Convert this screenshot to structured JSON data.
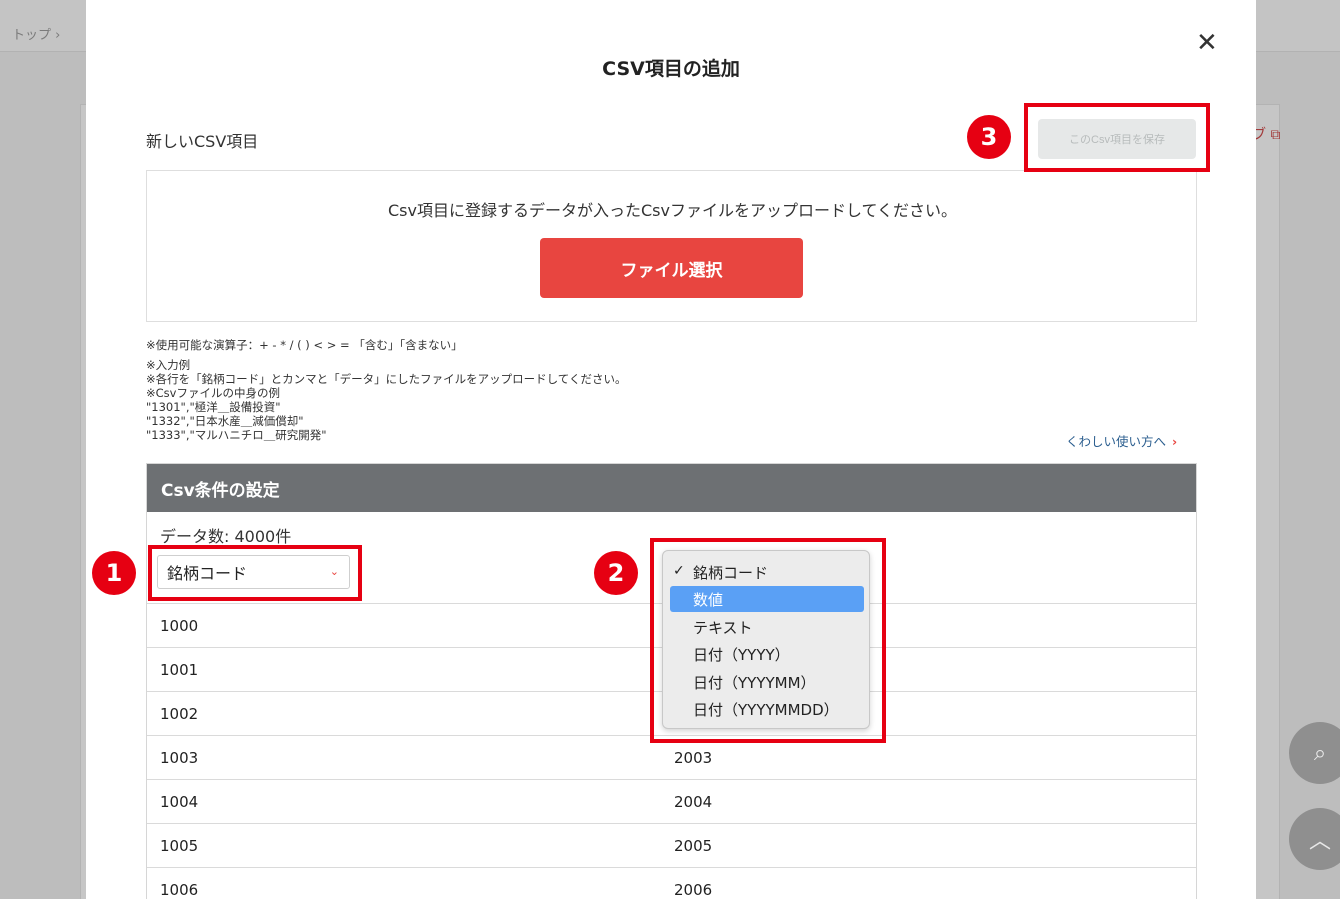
{
  "background": {
    "breadcrumb": "トップ ›",
    "external_link": "ブ ⧉"
  },
  "modal": {
    "title": "CSV項目の追加",
    "close": "✕",
    "section_label": "新しいCSV項目",
    "save_button": "このCsv項目を保存",
    "upload": {
      "message": "Csv項目に登録するデータが入ったCsvファイルをアップロードしてください。",
      "button": "ファイル選択"
    },
    "notes": {
      "operators": "※使用可能な演算子：+ - * / ( ) < > = 「含む」「含まない」",
      "input_example_heading": "※入力例",
      "instruction": "※各行を「銘柄コード」とカンマと「データ」にしたファイルをアップロードしてください。",
      "content_example_heading": "※Csvファイルの中身の例",
      "example_lines": [
        "\"1301\",\"極洋＿設備投資\"",
        "\"1332\",\"日本水産＿減価償却\"",
        "\"1333\",\"マルハニチロ＿研究開発\""
      ]
    },
    "help_link": "くわしい使い方へ",
    "help_link_chevron": "›",
    "conditions": {
      "header": "Csv条件の設定",
      "data_count": "データ数: 4000件",
      "column1_select": "銘柄コード",
      "select_arrow": "⌄",
      "rows": [
        {
          "c1": "1000",
          "c2": ""
        },
        {
          "c1": "1001",
          "c2": ""
        },
        {
          "c1": "1002",
          "c2": ""
        },
        {
          "c1": "1003",
          "c2": "2003"
        },
        {
          "c1": "1004",
          "c2": "2004"
        },
        {
          "c1": "1005",
          "c2": "2005"
        },
        {
          "c1": "1006",
          "c2": "2006"
        }
      ]
    },
    "dropdown": {
      "checkmark": "✓",
      "options": [
        {
          "label": "銘柄コード"
        },
        {
          "label": "数値"
        },
        {
          "label": "テキスト"
        },
        {
          "label": "日付（YYYY）"
        },
        {
          "label": "日付（YYYYMM）"
        },
        {
          "label": "日付（YYYYMMDD）"
        }
      ]
    }
  },
  "annotations": {
    "badge1": "1",
    "badge2": "2",
    "badge3": "3"
  },
  "fabs": {
    "search_glyph": "⌕",
    "up_glyph": "︿"
  },
  "colors": {
    "accent": "#e84540",
    "highlight": "#e60012",
    "selection": "#5aa0f5",
    "header_bg": "#6d7073"
  }
}
